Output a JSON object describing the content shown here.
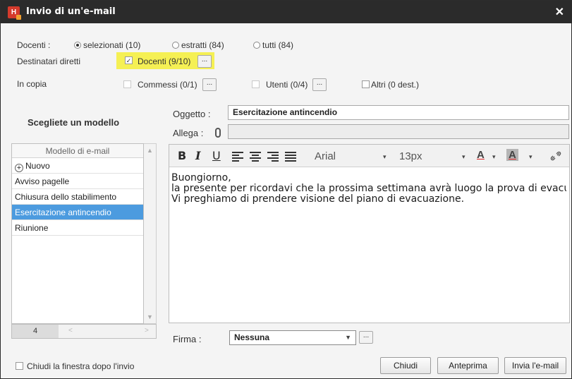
{
  "window": {
    "title": "Invio di un'e-mail",
    "logo_text": "H"
  },
  "recipients": {
    "docenti_label": "Docenti :",
    "options": {
      "selezionati": "selezionati (10)",
      "estratti": "estratti (84)",
      "tutti": "tutti (84)"
    },
    "selected_option": "selezionati",
    "direct_label": "Destinatari diretti",
    "direct_docenti": "Docenti (9/10)",
    "direct_docenti_checked": true,
    "cc_label": "In copia",
    "cc_commessi": "Commessi (0/1)",
    "cc_utenti": "Utenti (0/4)",
    "cc_altri": "Altri (0 dest.)",
    "dots": "..."
  },
  "templates": {
    "heading": "Scegliete un modello",
    "column_header": "Modello di e-mail",
    "new_label": "Nuovo",
    "items": [
      "Avviso pagelle",
      "Chiusura dello stabilimento",
      "Esercitazione antincendio",
      "Riunione"
    ],
    "selected_index": 2,
    "count": "4"
  },
  "message": {
    "subject_label": "Oggetto :",
    "subject_value": "Esercitazione antincendio",
    "attach_label": "Allega :",
    "attach_value": "",
    "font_name": "Arial",
    "font_size": "13px",
    "body_lines": [
      "Buongiorno,",
      "la presente per ricordavi che la prossima settimana avrà luogo la prova di evacuazione",
      "Vi preghiamo di prendere visione del piano di evacuazione."
    ],
    "signature_label": "Firma :",
    "signature_value": "Nessuna"
  },
  "toolbar": {
    "bold": "B",
    "italic": "I",
    "underline": "U",
    "fore_color": "A",
    "back_color": "A",
    "caret": "▾"
  },
  "footer": {
    "close_after_send": "Chiudi la finestra dopo l'invio",
    "close_btn": "Chiudi",
    "preview_btn": "Anteprima",
    "send_btn": "Invia l'e-mail"
  },
  "colors": {
    "titlebar": "#2b2b2b",
    "highlight": "#f5f054",
    "selection": "#4c9bdf"
  }
}
